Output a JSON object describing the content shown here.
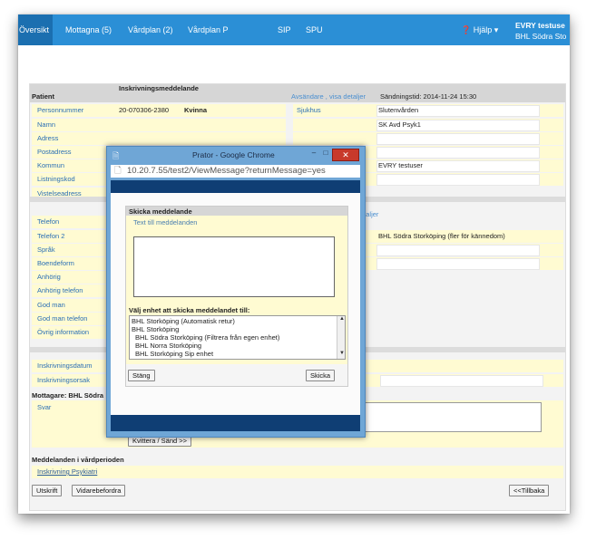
{
  "nav": {
    "tabs": [
      "Översikt",
      "Mottagna (5)",
      "Vårdplan (2)",
      "Vårdplan P",
      "SIP",
      "SPU"
    ],
    "help": "Hjälp",
    "user_name": "EVRY testuse",
    "user_unit": "BHL Södra Sto"
  },
  "page": {
    "section_title": "Inskrivningsmeddelande",
    "patient_label": "Patient",
    "sender_link": "Avsändare , visa detaljer",
    "sent_time": "Sändningstid: 2014-11-24 15:30",
    "patient_fields": [
      {
        "label": "Personnummer",
        "value": "20-070306-2380",
        "extra": "Kvinna"
      },
      {
        "label": "Namn",
        "value": ""
      },
      {
        "label": "Adress",
        "value": ""
      },
      {
        "label": "Postadress",
        "value": ""
      },
      {
        "label": "Kommun",
        "value": ""
      },
      {
        "label": "Listningskod",
        "value": ""
      },
      {
        "label": "Vistelseadress",
        "value": ""
      }
    ],
    "sender_fields": [
      {
        "label": "Sjukhus",
        "value": "Slutenvården"
      },
      {
        "label": "",
        "value": "SK Avd Psyk1"
      },
      {
        "label": "",
        "value": ""
      },
      {
        "label": "",
        "value": ""
      },
      {
        "label": "",
        "value": "EVRY testuser"
      }
    ],
    "detaljer_link": "etaljer",
    "recipient_value": "BHL Södra Storköping (fler för kännedom)",
    "patient_fields2": [
      "Telefon",
      "Telefon 2",
      "Språk",
      "Boendeform",
      "Anhörig",
      "Anhörig telefon",
      "God man",
      "God man telefon",
      "Övrig information"
    ],
    "ins_fields": [
      "Inskrivningsdatum",
      "Inskrivningsorsak"
    ],
    "receiver_label": "Mottagare: BHL Södra",
    "reply_label": "Svar",
    "kvittera_button": "Kvittera / Sänd >>",
    "messages_title": "Meddelanden i vårdperioden",
    "messages_link": "Inskrivning Psykiatri",
    "print_button": "Utskrift",
    "forward_button": "Vidarebefordra",
    "back_button": "<<Tillbaka"
  },
  "popup": {
    "title": "Prator - Google Chrome",
    "minimize": "–",
    "maximize": "□",
    "close": "✕",
    "url": "10.20.7.55/test2/ViewMessage?returnMessage=yes",
    "panel_title": "Skicka meddelande",
    "text_label": "Text till meddelanden",
    "text_value": "",
    "select_label": "Välj enhet att skicka meddelandet till:",
    "units": [
      "BHL Storköping (Automatisk retur)",
      "BHL Storköping",
      "BHL Södra Storköping (Filtrera från egen enhet)",
      "BHL Norra Storköping",
      "BHL Storköping Sip enhet"
    ],
    "close_button": "Stäng",
    "send_button": "Skicka"
  }
}
